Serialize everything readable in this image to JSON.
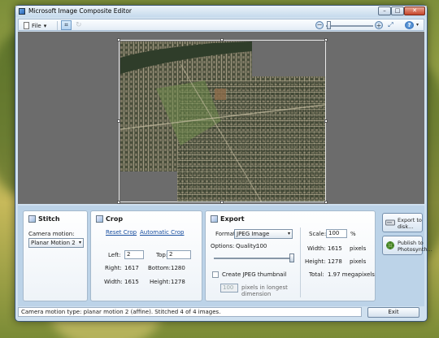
{
  "window": {
    "title": "Microsoft Image Composite Editor",
    "minimize_glyph": "–",
    "maximize_glyph": "□",
    "close_glyph": "✕"
  },
  "toolbar": {
    "file_label": "File",
    "file_caret": "▾",
    "crop_glyph": "⌗",
    "rotate_glyph": "↻",
    "zoom_out_glyph": "−",
    "zoom_in_glyph": "+",
    "fit_glyph": "⤢",
    "help_glyph": "?",
    "help_caret": "▾"
  },
  "stitch": {
    "title": "Stitch",
    "camera_motion_label": "Camera motion:",
    "camera_motion_value": "Planar Motion 2"
  },
  "crop": {
    "title": "Crop",
    "reset_link": "Reset Crop",
    "auto_link": "Automatic Crop",
    "left_label": "Left:",
    "left_value": "2",
    "top_label": "Top:",
    "top_value": "2",
    "right_label": "Right:",
    "right_value": "1617",
    "bottom_label": "Bottom:",
    "bottom_value": "1280",
    "width_label": "Width:",
    "width_value": "1615",
    "height_label": "Height:",
    "height_value": "1278"
  },
  "export": {
    "title": "Export",
    "format_label": "Format:",
    "format_value": "JPEG Image",
    "options_label": "Options:",
    "quality_label": "Quality:",
    "quality_value": "100",
    "quality_level": 1.0,
    "thumbnail_label": "Create JPEG thumbnail",
    "thumbnail_checked": false,
    "thumb_size_value": "100",
    "thumb_size_note": "pixels in longest dimension",
    "scale_label": "Scale:",
    "scale_value": "100",
    "scale_unit": "%",
    "width_label": "Width:",
    "width_value": "1615",
    "width_unit": "pixels",
    "height_label": "Height:",
    "height_value": "1278",
    "height_unit": "pixels",
    "total_label": "Total:",
    "total_value": "1.97 megapixels"
  },
  "actions": {
    "export_disk": "Export to disk...",
    "publish": "Publish to Photosynth..."
  },
  "status": {
    "text": "Camera motion type: planar motion 2 (affine). Stitched 4 of 4 images."
  },
  "exit_label": "Exit"
}
